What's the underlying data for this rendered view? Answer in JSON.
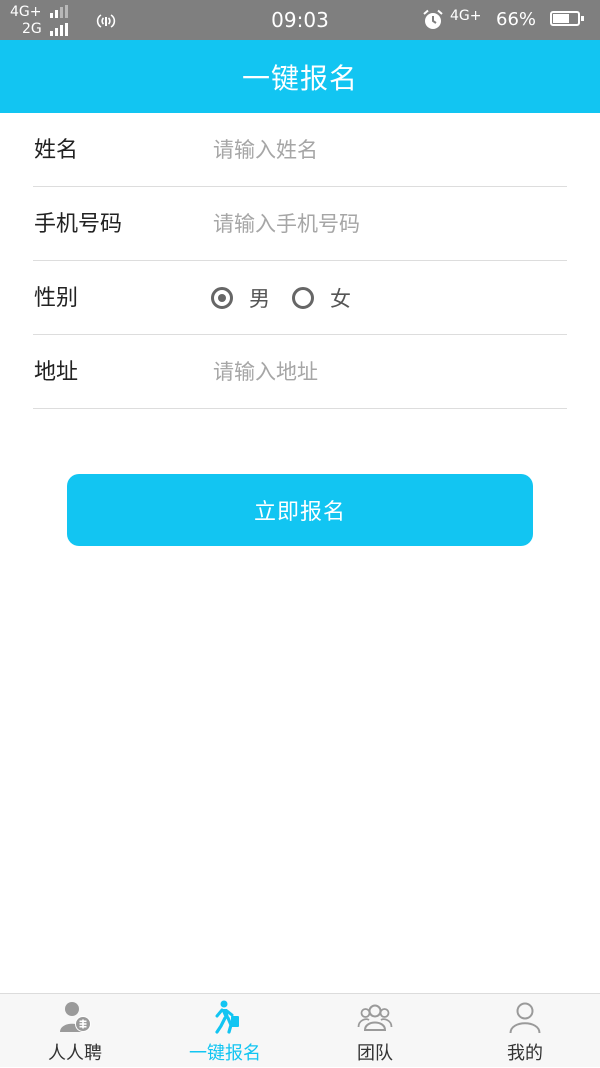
{
  "status_bar": {
    "network_top": "4G+",
    "network_bottom": "2G",
    "time": "09:03",
    "network_right": "4G+",
    "battery_text": "66%",
    "battery_level": 0.66
  },
  "header": {
    "title": "一键报名"
  },
  "form": {
    "name": {
      "label": "姓名",
      "placeholder": "请输入姓名",
      "value": ""
    },
    "phone": {
      "label": "手机号码",
      "placeholder": "请输入手机号码",
      "value": ""
    },
    "gender": {
      "label": "性别",
      "options": [
        {
          "label": "男",
          "checked": true
        },
        {
          "label": "女",
          "checked": false
        }
      ]
    },
    "address": {
      "label": "地址",
      "placeholder": "请输入地址",
      "value": ""
    }
  },
  "submit": {
    "label": "立即报名"
  },
  "bottom_nav": {
    "items": [
      {
        "label": "人人聘",
        "icon": "recruit-user-icon",
        "active": false
      },
      {
        "label": "一键报名",
        "icon": "walking-person-icon",
        "active": true
      },
      {
        "label": "团队",
        "icon": "team-icon",
        "active": false
      },
      {
        "label": "我的",
        "icon": "profile-icon",
        "active": false
      }
    ]
  },
  "colors": {
    "accent": "#12c5f2",
    "status_bar": "#7f7f7f",
    "inactive_icon": "#9a9a9a",
    "text": "#222222",
    "placeholder": "#a6a6a6"
  }
}
